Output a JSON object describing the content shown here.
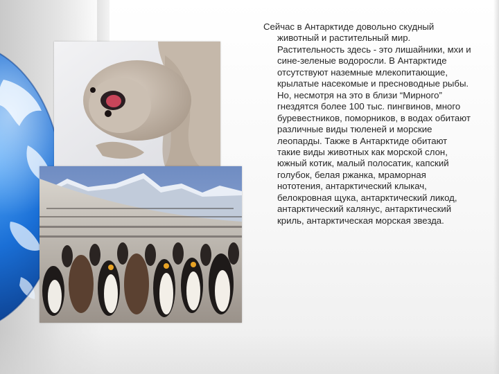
{
  "slide": {
    "text": "Сейчас в Антарктиде довольно скудный животный и растительный мир. Растительность здесь - это лишайники, мхи и сине-зеленые водоросли. В Антарктиде отсутствуют наземные млекопитающие, крылатые насекомые и пресноводные рыбы. Но, несмотря на это в близи “Мирного” гнездятся более 100 тыс. пингвинов, много буревестников, поморников, в водах обитают различные виды тюленей и морские леопарды. Также в Антарктиде обитают такие виды животных как морской слон, южный котик, малый полосатик, капский голубок, белая ржанка, мраморная нототения, антарктический клыкач, белокровная щука, антарктический ликод, антарктический калянус, антарктический криль, антарктическая морская звезда."
  },
  "images": {
    "seal": "seal-pup-photo",
    "penguins": "penguin-colony-photo",
    "globe": "globe-decoration"
  },
  "colors": {
    "text": "#262626",
    "globe_blue": "#1a6fd6",
    "background": "#f4f4f4"
  }
}
